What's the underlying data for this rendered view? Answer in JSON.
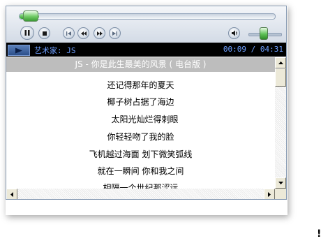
{
  "player": {
    "progress_fraction": 0.05,
    "volume_fraction": 0.45,
    "info": {
      "artist_label": "艺术家: JS",
      "time": "00:09 / 04:31"
    }
  },
  "lyrics": {
    "title": "JS - 你是此生最美的风景 ( 电台版 )",
    "lines": [
      "还记得那年的夏天",
      "椰子树占据了海边",
      "太阳光灿烂得刺眼",
      "你轻轻吻了我的脸",
      "飞机越过海面  划下微笑弧线",
      "就在一瞬间  你和我之间",
      "相隔一个世纪那涩远"
    ]
  },
  "stray_mark": "!",
  "colors": {
    "info_text": "#6fa0ff",
    "title_bar": "#bdbdbd",
    "seek_green": "#2ea12a"
  },
  "icons": [
    "pause-icon",
    "stop-icon",
    "previous-icon",
    "rewind-icon",
    "fast-forward-icon",
    "next-icon",
    "speaker-icon",
    "play-arrow-icon"
  ]
}
